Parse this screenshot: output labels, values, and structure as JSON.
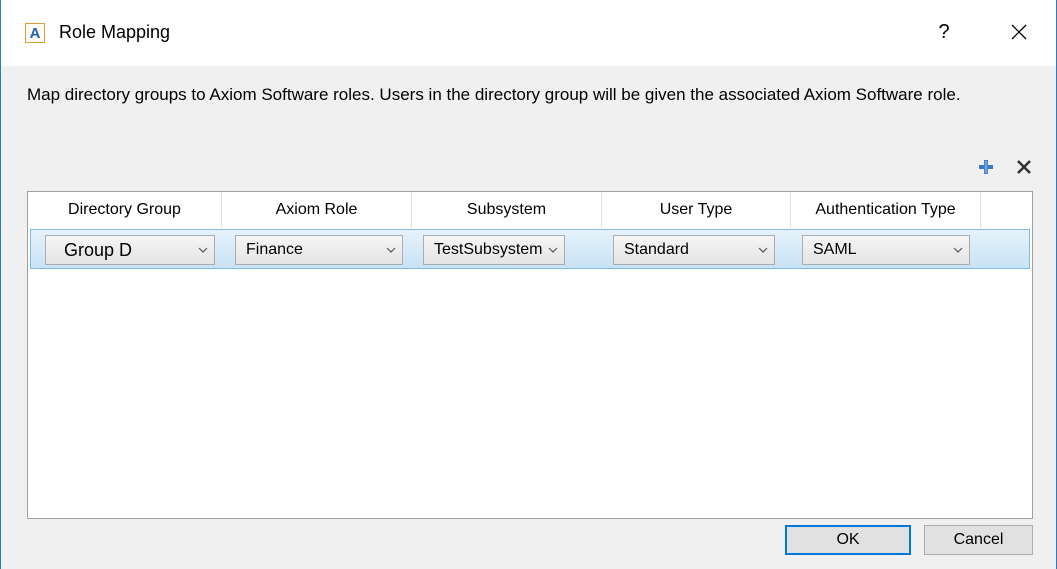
{
  "window": {
    "icon_letter": "A",
    "title": "Role Mapping",
    "help_label": "?",
    "accent_color": "#2b79c9"
  },
  "description": "Map directory groups to Axiom Software roles. Users in the directory group will be given the associated Axiom Software role.",
  "toolbar": {
    "add_icon": "plus-icon",
    "delete_icon": "x-icon"
  },
  "grid": {
    "columns": [
      "Directory Group",
      "Axiom Role",
      "Subsystem",
      "User Type",
      "Authentication Type"
    ],
    "rows": [
      {
        "directory_group": "Group D",
        "axiom_role": "Finance",
        "subsystem": "TestSubsystem",
        "user_type": "Standard",
        "authentication_type": "SAML"
      }
    ]
  },
  "buttons": {
    "ok": "OK",
    "cancel": "Cancel"
  }
}
